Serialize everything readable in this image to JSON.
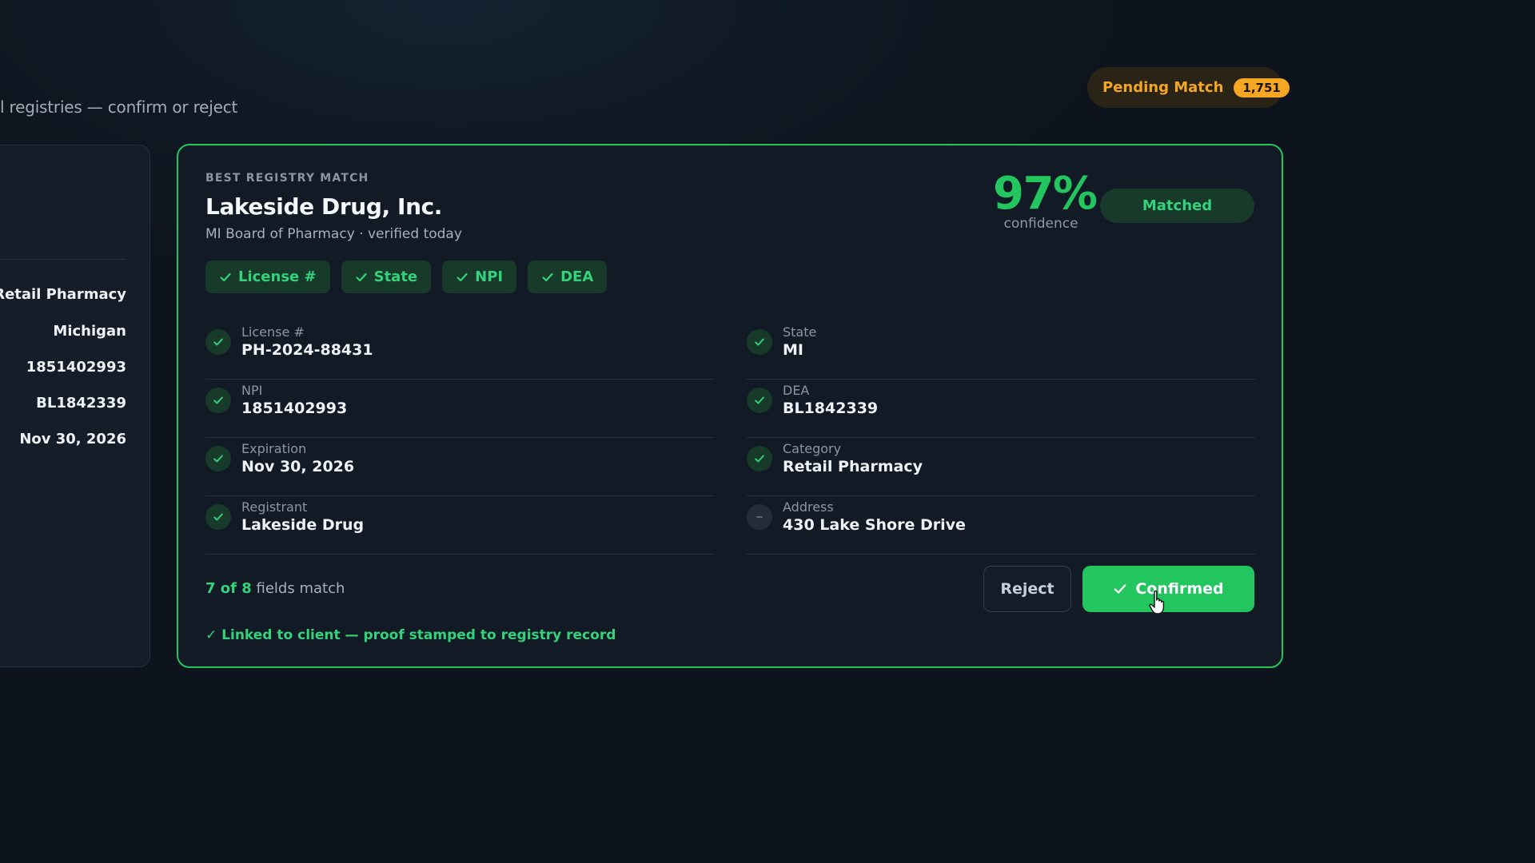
{
  "header": {
    "subtitle": "l registries — confirm or reject",
    "pending_label": "Pending Match",
    "pending_count": "1,751"
  },
  "left_panel": {
    "values": [
      "Retail Pharmacy",
      "Michigan",
      "1851402993",
      "BL1842339",
      "Nov 30, 2026"
    ]
  },
  "match": {
    "eyebrow": "BEST REGISTRY MATCH",
    "title": "Lakeside Drug, Inc.",
    "source": "MI Board of Pharmacy · verified today",
    "confidence_value": "97%",
    "confidence_label": "confidence",
    "status_badge": "Matched",
    "chips": [
      "License #",
      "State",
      "NPI",
      "DEA"
    ],
    "fields": [
      {
        "label": "License #",
        "value": "PH-2024-88431",
        "status": "match"
      },
      {
        "label": "State",
        "value": "MI",
        "status": "match"
      },
      {
        "label": "NPI",
        "value": "1851402993",
        "status": "match"
      },
      {
        "label": "DEA",
        "value": "BL1842339",
        "status": "match"
      },
      {
        "label": "Expiration",
        "value": "Nov 30, 2026",
        "status": "match"
      },
      {
        "label": "Category",
        "value": "Retail Pharmacy",
        "status": "match"
      },
      {
        "label": "Registrant",
        "value": "Lakeside Drug",
        "status": "match"
      },
      {
        "label": "Address",
        "value": "430 Lake Shore Drive",
        "status": "neutral"
      }
    ],
    "summary_count": "7 of 8",
    "summary_text": "fields match",
    "reject_label": "Reject",
    "confirm_label": "Confirmed",
    "linked_text": "✓ Linked to client — proof stamped to registry record"
  },
  "colors": {
    "accent": "#22c55e",
    "accent_text": "#34d27a",
    "pending": "#f5a623",
    "background": "#0f1822"
  },
  "icons": {
    "check": "check-icon",
    "neutral": "minus-icon",
    "cursor": "hand-pointer-cursor"
  }
}
